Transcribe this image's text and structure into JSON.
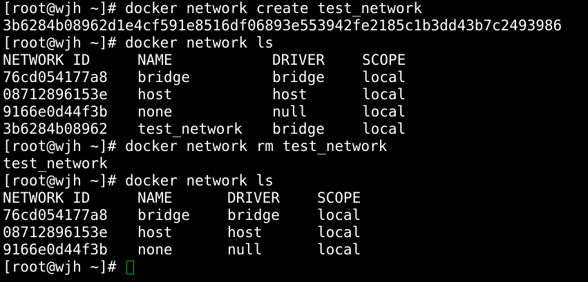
{
  "prompt": "[root@wjh ~]# ",
  "commands": {
    "create": "docker network create test_network",
    "ls1": "docker network ls",
    "rm": "docker network rm test_network",
    "ls2": "docker network ls"
  },
  "outputs": {
    "create_id": "3b6284b08962d1e4cf591e8516df06893e553942fe2185c1b3dd43b7c2493986",
    "rm_result": "test_network"
  },
  "table1": {
    "headers": [
      "NETWORK ID",
      "NAME",
      "DRIVER",
      "SCOPE"
    ],
    "rows": [
      [
        "76cd054177a8",
        "bridge",
        "bridge",
        "local"
      ],
      [
        "08712896153e",
        "host",
        "host",
        "local"
      ],
      [
        "9166e0d44f3b",
        "none",
        "null",
        "local"
      ],
      [
        "3b6284b08962",
        "test_network",
        "bridge",
        "local"
      ]
    ]
  },
  "table2": {
    "headers": [
      "NETWORK ID",
      "NAME",
      "DRIVER",
      "SCOPE"
    ],
    "rows": [
      [
        "76cd054177a8",
        "bridge",
        "bridge",
        "local"
      ],
      [
        "08712896153e",
        "host",
        "host",
        "local"
      ],
      [
        "9166e0d44f3b",
        "none",
        "null",
        "local"
      ]
    ]
  },
  "colors": {
    "background": "#000000",
    "text": "#ffffff",
    "cursor": "#00c000"
  }
}
